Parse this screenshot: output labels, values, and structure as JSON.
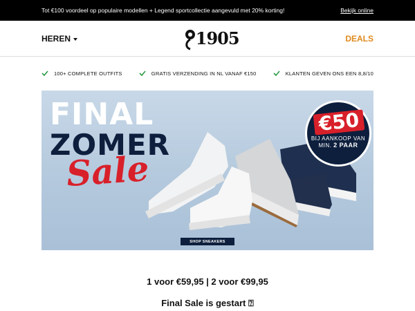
{
  "topbar": {
    "promo": "Tot €100 voordeel op populaire modellen + Legend sportcollectie aangevuld met 20% korting!",
    "view_online": "Bekijk online"
  },
  "header": {
    "menu_label": "HEREN",
    "logo_text": "1905",
    "deals_label": "DEALS"
  },
  "usps": [
    {
      "icon": "check-icon",
      "label": "100+ COMPLETE OUTFITS"
    },
    {
      "icon": "check-icon",
      "label": "GRATIS VERZENDING IN NL VANAF €150"
    },
    {
      "icon": "check-icon",
      "label": "KLANTEN GEVEN ONS EEN 8,8/10"
    }
  ],
  "hero": {
    "line1": "FINAL",
    "line2": "ZOMER",
    "line3": "Sale",
    "badge_amount": "€50",
    "badge_line1": "BIJ AANKOOP VAN",
    "badge_line2_prefix": "MIN. ",
    "badge_line2_bold": "2 PAAR",
    "cta": "SHOP SNEAKERS"
  },
  "offer": {
    "price_line": "1 voor €59,95 | 2 voor €99,95",
    "headline": "Final Sale is gestart ⍰"
  },
  "colors": {
    "accent": "#e08a1e",
    "navy": "#0d1f3d",
    "sale_red": "#d8202a",
    "check_green": "#2e9b45"
  }
}
